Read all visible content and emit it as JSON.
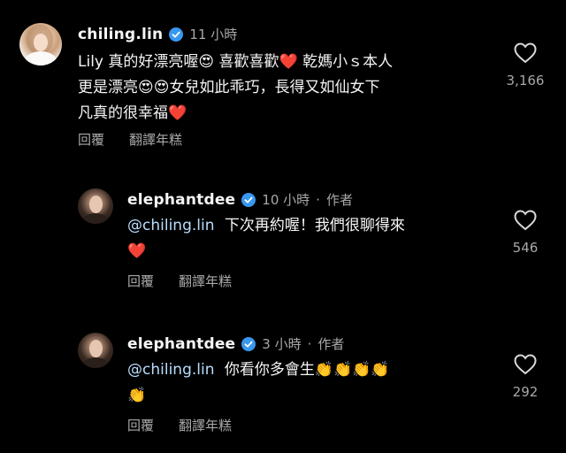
{
  "comments": [
    {
      "username": "chiling.lin",
      "time": "11 小時",
      "text_lines": [
        "Lily 真的好漂亮喔😍 喜歡喜歡❤️ 乾媽小ｓ本人",
        "更是漂亮😍😍女兒如此乖巧，長得又如仙女下",
        "凡真的很幸福❤️"
      ],
      "reply_label": "回覆",
      "translate_label": "翻譯年糕",
      "likes": "3,166"
    },
    {
      "username": "elephantdee",
      "time": "10 小時",
      "author_tag": "作者",
      "mention": "@chiling.lin",
      "text_lines": [
        "下次再約喔！我們很聊得來",
        "❤️"
      ],
      "reply_label": "回覆",
      "translate_label": "翻譯年糕",
      "likes": "546"
    },
    {
      "username": "elephantdee",
      "time": "3 小時",
      "author_tag": "作者",
      "mention": "@chiling.lin",
      "text_lines": [
        "你看你多會生👏👏👏👏",
        "👏"
      ],
      "reply_label": "回覆",
      "translate_label": "翻譯年糕",
      "likes": "292"
    }
  ],
  "colors": {
    "background": "#000000",
    "text": "#f5f5f5",
    "secondary": "#a8a8a8",
    "mention": "#b9dcff",
    "verified": "#3897f0"
  }
}
